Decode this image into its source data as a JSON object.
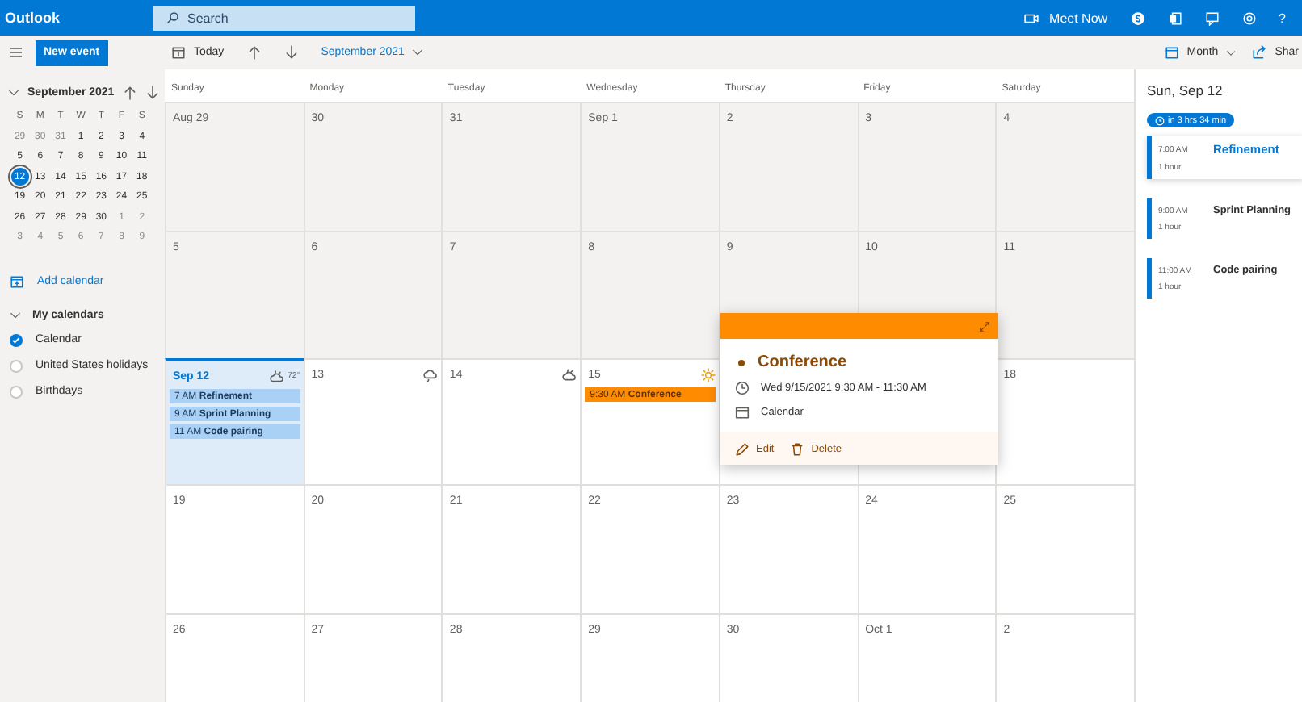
{
  "app": {
    "title": "Outlook",
    "search": {
      "placeholder": "Search"
    },
    "meet_now": "Meet Now",
    "help": "?"
  },
  "toolbar": {
    "new_event": "New event",
    "today": "Today",
    "period": "September 2021",
    "view": "Month",
    "share": "Shar"
  },
  "mini_calendar": {
    "title": "September 2021",
    "weekdays": [
      "S",
      "M",
      "T",
      "W",
      "T",
      "F",
      "S"
    ],
    "weeks": [
      [
        {
          "d": "29",
          "other": true,
          "selected": false
        },
        {
          "d": "30",
          "other": true,
          "selected": false
        },
        {
          "d": "31",
          "other": true,
          "selected": false
        },
        {
          "d": "1",
          "other": false,
          "selected": false
        },
        {
          "d": "2",
          "other": false,
          "selected": false
        },
        {
          "d": "3",
          "other": false,
          "selected": false
        },
        {
          "d": "4",
          "other": false,
          "selected": false
        }
      ],
      [
        {
          "d": "5",
          "other": false,
          "selected": false
        },
        {
          "d": "6",
          "other": false,
          "selected": false
        },
        {
          "d": "7",
          "other": false,
          "selected": false
        },
        {
          "d": "8",
          "other": false,
          "selected": false
        },
        {
          "d": "9",
          "other": false,
          "selected": false
        },
        {
          "d": "10",
          "other": false,
          "selected": false
        },
        {
          "d": "11",
          "other": false,
          "selected": false
        }
      ],
      [
        {
          "d": "12",
          "other": false,
          "selected": true
        },
        {
          "d": "13",
          "other": false,
          "selected": false
        },
        {
          "d": "14",
          "other": false,
          "selected": false
        },
        {
          "d": "15",
          "other": false,
          "selected": false
        },
        {
          "d": "16",
          "other": false,
          "selected": false
        },
        {
          "d": "17",
          "other": false,
          "selected": false
        },
        {
          "d": "18",
          "other": false,
          "selected": false
        }
      ],
      [
        {
          "d": "19",
          "other": false,
          "selected": false
        },
        {
          "d": "20",
          "other": false,
          "selected": false
        },
        {
          "d": "21",
          "other": false,
          "selected": false
        },
        {
          "d": "22",
          "other": false,
          "selected": false
        },
        {
          "d": "23",
          "other": false,
          "selected": false
        },
        {
          "d": "24",
          "other": false,
          "selected": false
        },
        {
          "d": "25",
          "other": false,
          "selected": false
        }
      ],
      [
        {
          "d": "26",
          "other": false,
          "selected": false
        },
        {
          "d": "27",
          "other": false,
          "selected": false
        },
        {
          "d": "28",
          "other": false,
          "selected": false
        },
        {
          "d": "29",
          "other": false,
          "selected": false
        },
        {
          "d": "30",
          "other": false,
          "selected": false
        },
        {
          "d": "1",
          "other": true,
          "selected": false
        },
        {
          "d": "2",
          "other": true,
          "selected": false
        }
      ],
      [
        {
          "d": "3",
          "other": true,
          "selected": false
        },
        {
          "d": "4",
          "other": true,
          "selected": false
        },
        {
          "d": "5",
          "other": true,
          "selected": false
        },
        {
          "d": "6",
          "other": true,
          "selected": false
        },
        {
          "d": "7",
          "other": true,
          "selected": false
        },
        {
          "d": "8",
          "other": true,
          "selected": false
        },
        {
          "d": "9",
          "other": true,
          "selected": false
        }
      ]
    ]
  },
  "sidebar": {
    "add_calendar": "Add calendar",
    "group": {
      "label": "My calendars",
      "expanded": true
    },
    "calendars": [
      {
        "label": "Calendar",
        "checked": true
      },
      {
        "label": "United States holidays",
        "checked": false
      },
      {
        "label": "Birthdays",
        "checked": false
      }
    ]
  },
  "month": {
    "weekdays": [
      "Sunday",
      "Monday",
      "Tuesday",
      "Wednesday",
      "Thursday",
      "Friday",
      "Saturday"
    ],
    "weeks": [
      [
        {
          "label": "Aug 29",
          "past": true,
          "selected": false
        },
        {
          "label": "30",
          "past": true,
          "selected": false
        },
        {
          "label": "31",
          "past": true,
          "selected": false
        },
        {
          "label": "Sep 1",
          "past": true,
          "selected": false
        },
        {
          "label": "2",
          "past": true,
          "selected": false
        },
        {
          "label": "3",
          "past": true,
          "selected": false
        },
        {
          "label": "4",
          "past": true,
          "selected": false
        }
      ],
      [
        {
          "label": "5",
          "past": true,
          "selected": false
        },
        {
          "label": "6",
          "past": true,
          "selected": false
        },
        {
          "label": "7",
          "past": true,
          "selected": false
        },
        {
          "label": "8",
          "past": true,
          "selected": false
        },
        {
          "label": "9",
          "past": true,
          "selected": false
        },
        {
          "label": "10",
          "past": true,
          "selected": false
        },
        {
          "label": "11",
          "past": true,
          "selected": false
        }
      ],
      [
        {
          "label": "Sep 12",
          "past": false,
          "selected": true,
          "weather": {
            "kind": "partly-cloudy"
          },
          "temperature": "72°",
          "events": [
            {
              "time": "7 AM",
              "title": "Refinement",
              "kind": "chip"
            },
            {
              "time": "9 AM",
              "title": "Sprint Planning",
              "kind": "chip"
            },
            {
              "time": "11 AM",
              "title": "Code pairing",
              "kind": "chip"
            }
          ]
        },
        {
          "label": "13",
          "past": false,
          "selected": false,
          "weather": {
            "kind": "rain"
          }
        },
        {
          "label": "14",
          "past": false,
          "selected": false,
          "weather": {
            "kind": "partly-cloudy"
          }
        },
        {
          "label": "15",
          "past": false,
          "selected": false,
          "weather": {
            "kind": "sunny"
          },
          "events": [
            {
              "time": "9:30 AM",
              "title": "Conference",
              "kind": "highlight"
            }
          ]
        },
        {
          "past": false,
          "selected": false
        },
        {
          "past": false,
          "selected": false
        },
        {
          "label": "18",
          "past": false,
          "selected": false
        }
      ],
      [
        {
          "label": "19",
          "past": false,
          "selected": false
        },
        {
          "label": "20",
          "past": false,
          "selected": false
        },
        {
          "label": "21",
          "past": false,
          "selected": false
        },
        {
          "label": "22",
          "past": false,
          "selected": false
        },
        {
          "label": "23",
          "past": false,
          "selected": false
        },
        {
          "label": "24",
          "past": false,
          "selected": false
        },
        {
          "label": "25",
          "past": false,
          "selected": false
        }
      ],
      [
        {
          "label": "26",
          "past": false,
          "selected": false
        },
        {
          "label": "27",
          "past": false,
          "selected": false
        },
        {
          "label": "28",
          "past": false,
          "selected": false
        },
        {
          "label": "29",
          "past": false,
          "selected": false
        },
        {
          "label": "30",
          "past": false,
          "selected": false
        },
        {
          "label": "Oct 1",
          "past": false,
          "selected": false
        },
        {
          "label": "2",
          "past": false,
          "selected": false
        }
      ]
    ]
  },
  "popup": {
    "title": "Conference",
    "when": "Wed 9/15/2021 9:30 AM - 11:30 AM",
    "calendar": "Calendar",
    "edit": "Edit",
    "delete": "Delete"
  },
  "agenda": {
    "date": "Sun, Sep 12",
    "countdown": "in 3 hrs 34 min",
    "events": [
      {
        "time": "7:00 AM",
        "title": "Refinement",
        "duration": "1 hour",
        "selected": true
      },
      {
        "time": "9:00 AM",
        "title": "Sprint Planning",
        "duration": "1 hour",
        "selected": false
      },
      {
        "time": "11:00 AM",
        "title": "Code pairing",
        "duration": "1 hour",
        "selected": false
      }
    ]
  }
}
